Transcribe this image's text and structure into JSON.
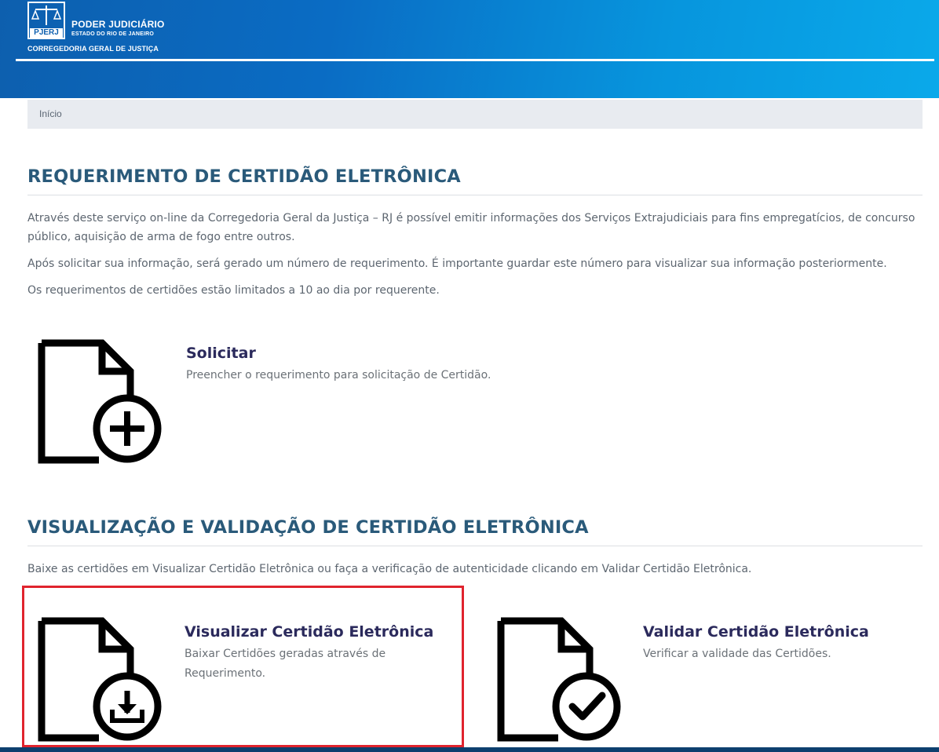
{
  "header": {
    "logo_abbr": "PJERJ",
    "org_line1": "PODER JUDICIÁRIO",
    "org_line2": "ESTADO DO RIO DE JANEIRO",
    "org_line3": "CORREGEDORIA GERAL DE JUSTIÇA"
  },
  "breadcrumb": {
    "home": "Início"
  },
  "section1": {
    "title": "REQUERIMENTO DE CERTIDÃO ELETRÔNICA",
    "paragraphs": [
      "Através deste serviço on-line da Corregedoria Geral da Justiça – RJ é possível emitir informações dos Serviços Extrajudiciais para fins empregatícios, de concurso público, aquisição de arma de fogo entre outros.",
      "Após solicitar sua informação, será gerado um número de requerimento. É importante guardar este número para visualizar sua informação posteriormente.",
      "Os requerimentos de certidões estão limitados a 10 ao dia por requerente."
    ],
    "card": {
      "title": "Solicitar",
      "description": "Preencher o requerimento para solicitação de Certidão.",
      "icon": "document-plus-icon"
    }
  },
  "section2": {
    "title": "VISUALIZAÇÃO E VALIDAÇÃO DE CERTIDÃO ELETRÔNICA",
    "intro": "Baixe as certidões em Visualizar Certidão Eletrônica ou faça a verificação de autenticidade clicando em Validar Certidão Eletrônica.",
    "cards": [
      {
        "title": "Visualizar Certidão Eletrônica",
        "description": "Baixar Certidões geradas através de Requerimento.",
        "icon": "document-download-icon"
      },
      {
        "title": "Validar Certidão Eletrônica",
        "description": "Verificar a validade das Certidões.",
        "icon": "document-check-icon"
      }
    ]
  },
  "colors": {
    "header_start": "#0d5fae",
    "header_end": "#0aa9ea",
    "heading": "#2a5a7a",
    "card_title": "#2b2a5c",
    "highlight": "#e0242e"
  }
}
